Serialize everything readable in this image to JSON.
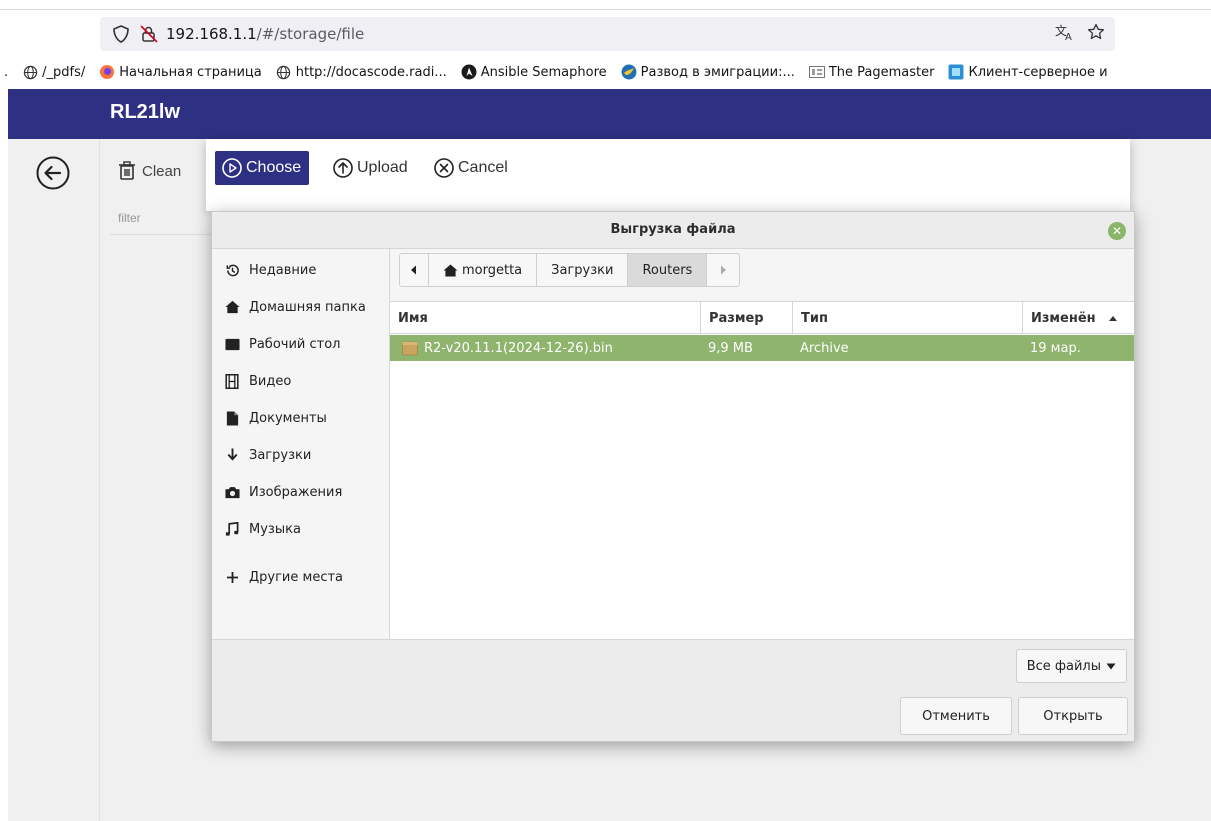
{
  "browser": {
    "url_host": "192.168.1.1",
    "url_path": "/#/storage/file",
    "bookmarks": [
      ".",
      "/_pdfs/",
      "Начальная страница",
      "http://docascode.radi...",
      "Ansible Semaphore",
      "Развод в эмиграции:...",
      "The Pagemaster",
      "Клиент-серверное и"
    ]
  },
  "app": {
    "title": "RL21lw",
    "clean_label": "Clean",
    "filter_label": "filter",
    "upload": {
      "choose": "Choose",
      "upload": "Upload",
      "cancel": "Cancel"
    }
  },
  "dialog": {
    "title": "Выгрузка файла",
    "places": [
      {
        "label": "Недавние",
        "icon": "recent-icon"
      },
      {
        "label": "Домашняя папка",
        "icon": "home-icon"
      },
      {
        "label": "Рабочий стол",
        "icon": "desktop-icon"
      },
      {
        "label": "Видео",
        "icon": "video-icon"
      },
      {
        "label": "Документы",
        "icon": "document-icon"
      },
      {
        "label": "Загрузки",
        "icon": "download-icon"
      },
      {
        "label": "Изображения",
        "icon": "camera-icon"
      },
      {
        "label": "Музыка",
        "icon": "music-icon"
      },
      {
        "label": "Другие места",
        "icon": "plus-icon"
      }
    ],
    "breadcrumbs": [
      "morgetta",
      "Загрузки",
      "Routers"
    ],
    "columns": {
      "name": "Имя",
      "size": "Размер",
      "type": "Тип",
      "modified": "Изменён"
    },
    "files": [
      {
        "name": "R2-v20.11.1(2024-12-26).bin",
        "size": "9,9 MB",
        "type": "Archive",
        "modified": "19 мар."
      }
    ],
    "filter_combo": "Все файлы",
    "cancel_button": "Отменить",
    "open_button": "Открыть",
    "selection_color": "#8fb46d"
  },
  "colors": {
    "app_bar": "#2e3183"
  }
}
